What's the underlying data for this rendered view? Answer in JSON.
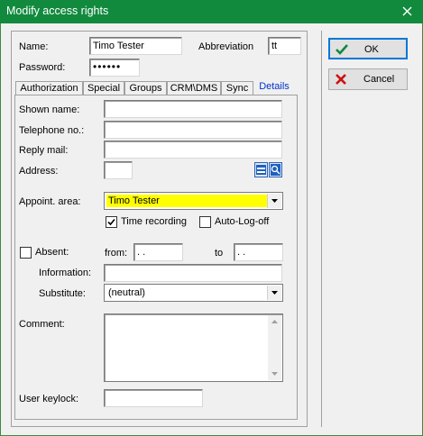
{
  "window": {
    "title": "Modify access rights",
    "close_label": "X"
  },
  "header": {
    "name_label": "Name:",
    "name_value": "Timo Tester",
    "abbrev_label": "Abbreviation",
    "abbrev_value": "tt",
    "password_label": "Password:",
    "password_value": "••••••"
  },
  "tabs": [
    "Authorization",
    "Special",
    "Groups",
    "CRM\\DMS",
    "Sync",
    "Details"
  ],
  "active_tab": "Details",
  "details": {
    "shown_name_label": "Shown name:",
    "shown_name_value": "",
    "telephone_label": "Telephone no.:",
    "telephone_value": "",
    "reply_mail_label": "Reply mail:",
    "reply_mail_value": "",
    "address_label": "Address:",
    "address_value": "",
    "appoint_area_label": "Appoint. area:",
    "appoint_area_value": "Timo Tester",
    "appoint_area_highlight": "#ffff00",
    "time_recording_label": "Time recording",
    "time_recording_checked": true,
    "auto_logoff_label": "Auto-Log-off",
    "auto_logoff_checked": false,
    "absent_label": "Absent:",
    "absent_checked": false,
    "from_label": "from:",
    "from_value": " .  .",
    "to_label": "to",
    "to_value": " .  .",
    "information_label": "Information:",
    "information_value": "",
    "substitute_label": "Substitute:",
    "substitute_value": "(neutral)",
    "comment_label": "Comment:",
    "comment_value": "",
    "user_keylock_label": "User keylock:",
    "user_keylock_value": ""
  },
  "buttons": {
    "ok_label": "OK",
    "cancel_label": "Cancel"
  },
  "colors": {
    "titlebar": "#118a3e",
    "active_tab_text": "#0033cc",
    "ok_icon": "#118a3e",
    "cancel_icon": "#cc1111"
  }
}
